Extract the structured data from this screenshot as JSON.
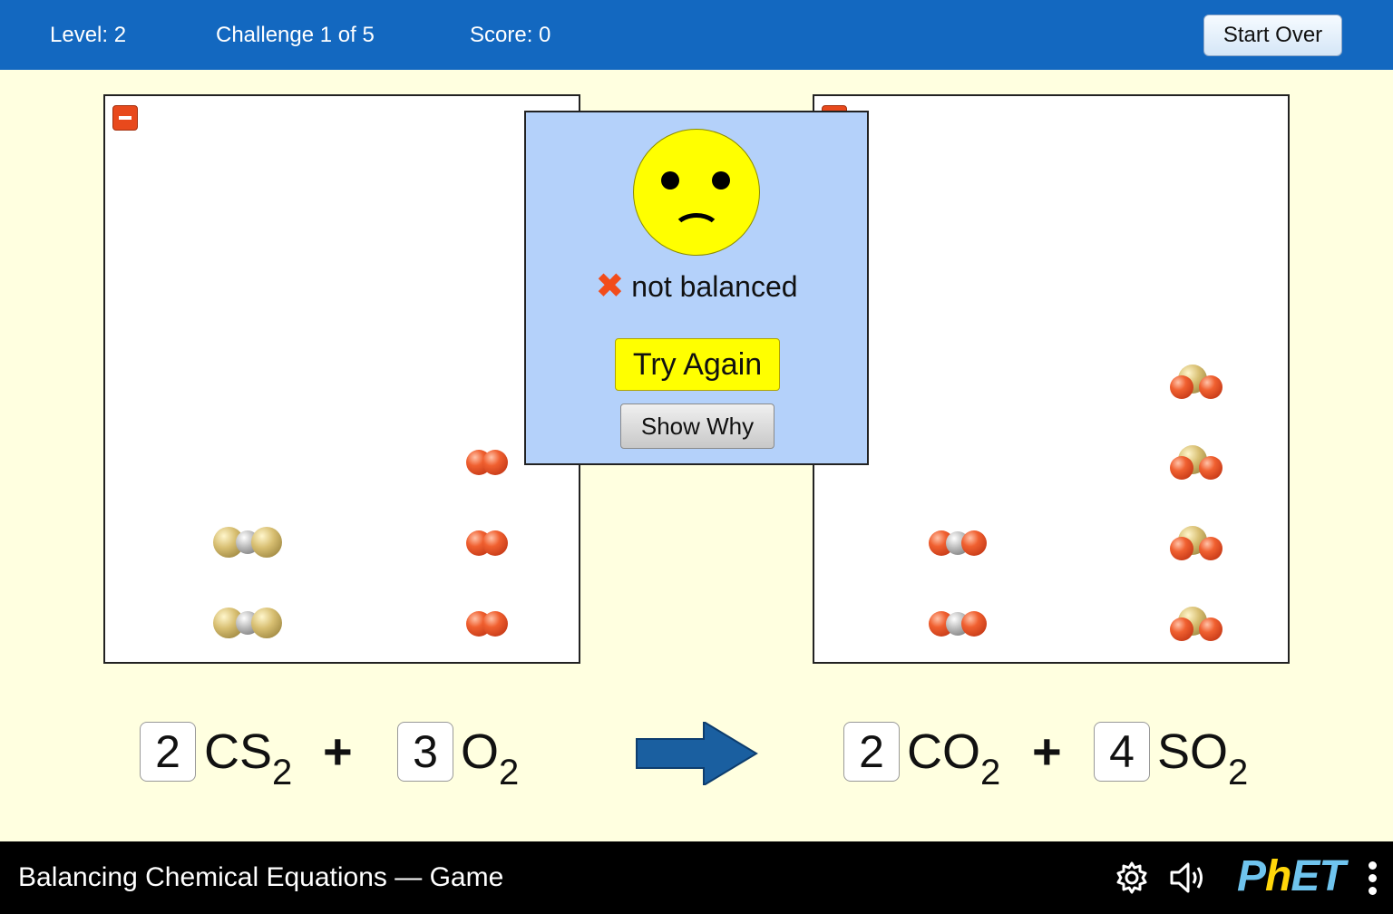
{
  "status_bar": {
    "level": "Level: 2",
    "challenge": "Challenge 1 of 5",
    "score": "Score: 0",
    "start_over_label": "Start Over"
  },
  "popup": {
    "result_text": "not balanced",
    "try_again_label": "Try Again",
    "show_why_label": "Show Why",
    "face": "sad-face-icon"
  },
  "equation": {
    "reactants": [
      {
        "coefficient": "2",
        "formula": "CS",
        "subscript": "2"
      },
      {
        "coefficient": "3",
        "formula": "O",
        "subscript": "2"
      }
    ],
    "products": [
      {
        "coefficient": "2",
        "formula": "CO",
        "subscript": "2"
      },
      {
        "coefficient": "4",
        "formula": "SO",
        "subscript": "2"
      }
    ],
    "plus": "+"
  },
  "boxes": {
    "reactants_visible": {
      "CS2": 2,
      "O2": 3
    },
    "products_visible": {
      "CO2": 2,
      "SO2": 4
    }
  },
  "footer": {
    "sim_title": "Balancing Chemical Equations — Game",
    "logo": {
      "p1": "P",
      "p2": "h",
      "p3": "ET"
    }
  },
  "colors": {
    "accent_bar": "#1368c0",
    "background": "#ffffe0",
    "popup_bg": "#b4d1fa",
    "try_again_bg": "#ffff00",
    "oxygen": "#f06030",
    "sulfur": "#d8bf72",
    "carbon": "#b8b8b8"
  }
}
